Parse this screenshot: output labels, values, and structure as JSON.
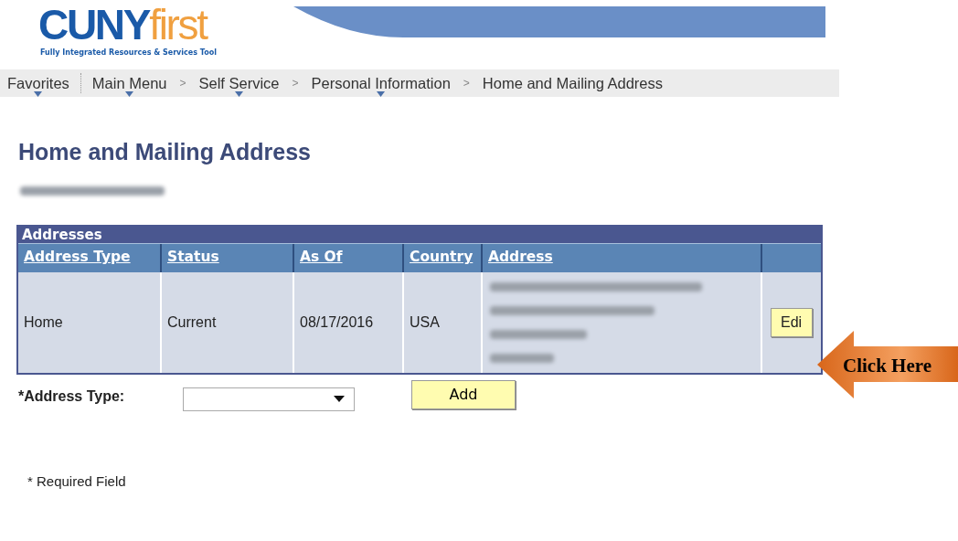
{
  "logo": {
    "name": "CUNY",
    "suffix": "first",
    "tagline": "Fully Integrated Resources & Services Tool"
  },
  "breadcrumbs": {
    "separator": ">",
    "items": [
      {
        "label": "Favorites",
        "has_menu": true
      },
      {
        "label": "Main Menu",
        "has_menu": true
      },
      {
        "label": "Self Service",
        "has_menu": true
      },
      {
        "label": "Personal Information",
        "has_menu": true
      },
      {
        "label": "Home and Mailing Address",
        "has_menu": false
      }
    ]
  },
  "page_title": "Home and Mailing Address",
  "addresses": {
    "title": "Addresses",
    "columns": [
      "Address Type",
      "Status",
      "As Of",
      "Country",
      "Address"
    ],
    "rows": [
      {
        "cells": [
          "Home",
          "Current",
          "08/17/2016",
          "USA"
        ],
        "button": "Edi"
      }
    ]
  },
  "address_type": {
    "label": "*Address Type:",
    "add_button": "Add"
  },
  "required_note": "* Required Field",
  "callout": "Click Here"
}
